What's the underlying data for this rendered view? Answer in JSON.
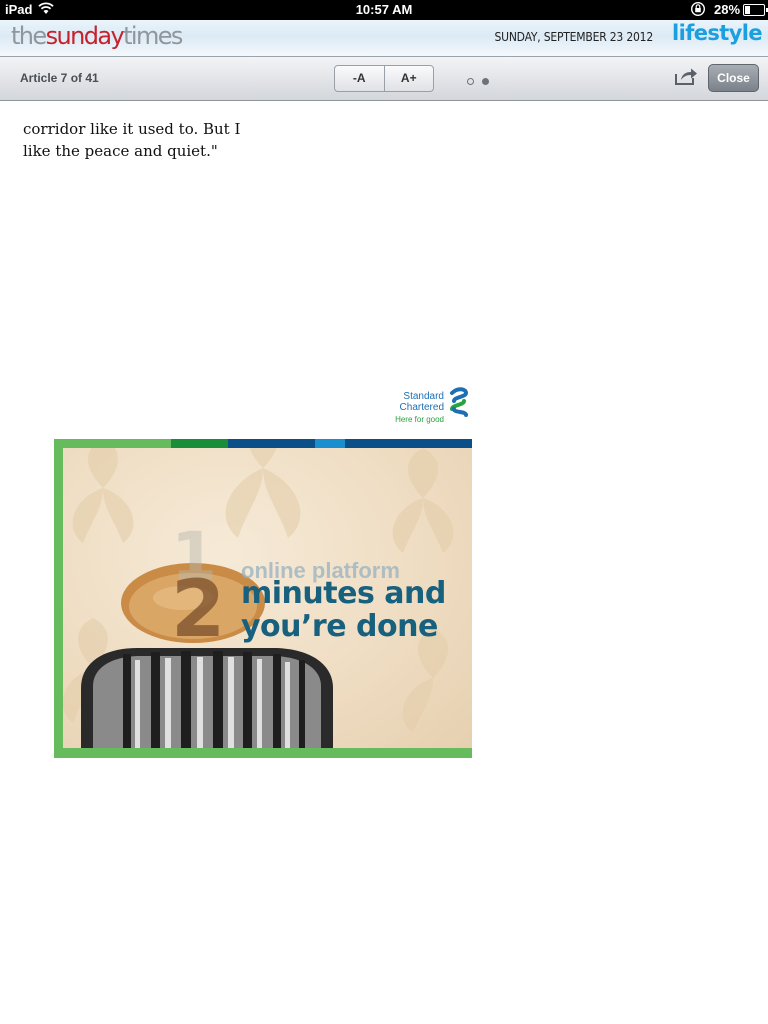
{
  "status_bar": {
    "device": "iPad",
    "time": "10:57 AM",
    "battery": "28%",
    "battery_level": 0.28,
    "icons": [
      "wifi-icon",
      "orientation-lock-icon",
      "battery-icon"
    ]
  },
  "masthead": {
    "logo": {
      "part1": "the",
      "part2": "sunday",
      "part3": "times"
    },
    "date": "SUNDAY, SEPTEMBER 23 2012",
    "section": "lifestyle",
    "colors": {
      "logo_grey": "#8f969c",
      "logo_red": "#c5222b",
      "section_blue": "#1a9fe0"
    }
  },
  "toolbar": {
    "article_counter": "Article 7 of 41",
    "decrease_font_label": "-A",
    "increase_font_label": "A+",
    "page_indicator": {
      "pages": 2,
      "current": 2
    },
    "close_label": "Close",
    "share_icon": "share-icon"
  },
  "article": {
    "lines": [
      "corridor like it used to. But I",
      "like the peace and quiet.\""
    ]
  },
  "advertisement": {
    "brand_line1": "Standard",
    "brand_line2": "Chartered",
    "tagline": "Here for good",
    "number_faded": "1",
    "number_main": "2",
    "headline_faded": "online platform",
    "headline_line1": "minutes and",
    "headline_line2": "you’re done",
    "colors": {
      "frame_green": "#66bb5c",
      "stripes": [
        "#66bb5c",
        "#1a8d3a",
        "#0b4f88",
        "#1a8fd0",
        "#0b4f88"
      ],
      "headline_blue": "#17607e"
    }
  }
}
